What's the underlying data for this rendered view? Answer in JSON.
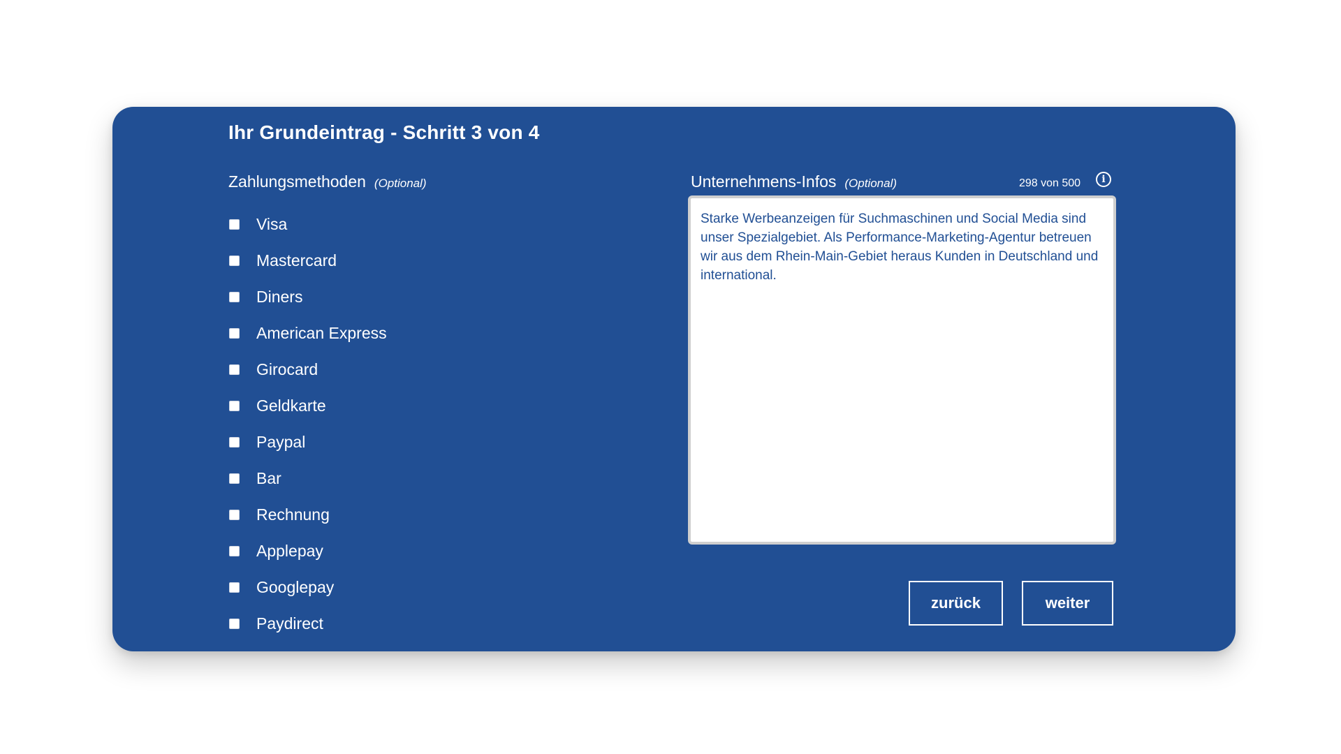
{
  "form": {
    "title": "Ihr Grundeintrag - Schritt 3 von 4",
    "payment_methods": {
      "label": "Zahlungsmethoden",
      "optional": "(Optional)",
      "options": [
        "Visa",
        "Mastercard",
        "Diners",
        "American Express",
        "Girocard",
        "Geldkarte",
        "Paypal",
        "Bar",
        "Rechnung",
        "Applepay",
        "Googlepay",
        "Paydirect"
      ]
    },
    "company_info": {
      "label": "Unternehmens-Infos",
      "optional": "(Optional)",
      "counter": "298 von 500",
      "info_icon": "info-icon",
      "value": "Starke Werbeanzeigen für Suchmaschinen und Social Media sind unser Spezialgebiet. Als Performance-Marketing-Agentur betreuen wir aus dem Rhein-Main-Gebiet heraus Kunden in Deutschland und international."
    },
    "buttons": {
      "back": "zurück",
      "next": "weiter"
    }
  },
  "colors": {
    "card_background": "#214f94",
    "text": "#ffffff",
    "textarea_text": "#214f94"
  }
}
